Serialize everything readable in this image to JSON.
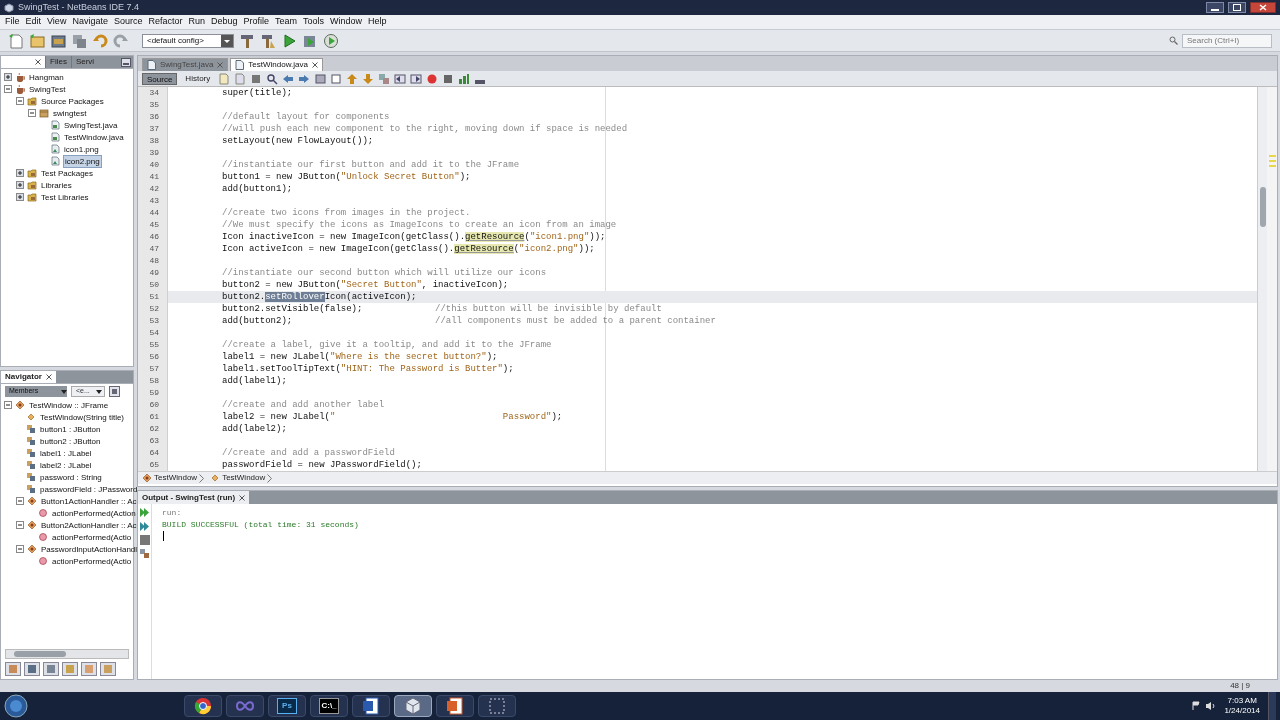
{
  "window": {
    "title": "SwingTest - NetBeans IDE 7.4"
  },
  "menu": [
    "File",
    "Edit",
    "View",
    "Navigate",
    "Source",
    "Refactor",
    "Run",
    "Debug",
    "Profile",
    "Team",
    "Tools",
    "Window",
    "Help"
  ],
  "toolbar": {
    "config": "<default config>",
    "search_placeholder": "Search (Ctrl+I)"
  },
  "projects_panel": {
    "tabs": [
      {
        "selected": true
      },
      {
        "label": "Files",
        "selected": false
      },
      {
        "label": "Servi",
        "selected": false
      }
    ],
    "tree": [
      {
        "label": "Hangman",
        "kind": "project",
        "expanded": false,
        "selected": false
      },
      {
        "label": "SwingTest",
        "kind": "project",
        "expanded": true,
        "selected": false,
        "children": [
          {
            "label": "Source Packages",
            "kind": "folder",
            "expanded": true,
            "selected": false,
            "children": [
              {
                "label": "swingtest",
                "kind": "package",
                "expanded": true,
                "selected": false,
                "children": [
                  {
                    "label": "SwingTest.java",
                    "kind": "java",
                    "selected": false
                  },
                  {
                    "label": "TestWindow.java",
                    "kind": "java",
                    "selected": false
                  },
                  {
                    "label": "icon1.png",
                    "kind": "image",
                    "selected": false
                  },
                  {
                    "label": "icon2.png",
                    "kind": "image",
                    "selected": true
                  }
                ]
              }
            ]
          },
          {
            "label": "Test Packages",
            "kind": "folder",
            "expanded": false,
            "selected": false
          },
          {
            "label": "Libraries",
            "kind": "folder",
            "expanded": false,
            "selected": false
          },
          {
            "label": "Test Libraries",
            "kind": "folder",
            "expanded": false,
            "selected": false
          }
        ]
      }
    ]
  },
  "navigator": {
    "title": "Navigator",
    "filter": "Members",
    "filter_2": "<e...",
    "tree": [
      {
        "label": "TestWindow :: JFrame",
        "kind": "class",
        "expanded": true,
        "children": [
          {
            "label": "TestWindow(String title)",
            "kind": "constructor"
          },
          {
            "label": "button1 : JButton",
            "kind": "field"
          },
          {
            "label": "button2 : JButton",
            "kind": "field"
          },
          {
            "label": "label1 : JLabel",
            "kind": "field"
          },
          {
            "label": "label2 : JLabel",
            "kind": "field"
          },
          {
            "label": "password : String",
            "kind": "field"
          },
          {
            "label": "passwordField : JPassword",
            "kind": "field"
          },
          {
            "label": "Button1ActionHandler :: Ac",
            "kind": "class",
            "expanded": true,
            "children": [
              {
                "label": "actionPerformed(Action",
                "kind": "method"
              }
            ]
          },
          {
            "label": "Button2ActionHandler :: Ac",
            "kind": "class",
            "expanded": true,
            "children": [
              {
                "label": "actionPerformed(Actio",
                "kind": "method"
              }
            ]
          },
          {
            "label": "PasswordInputActionHandl",
            "kind": "class",
            "expanded": true,
            "children": [
              {
                "label": "actionPerformed(Actio",
                "kind": "method"
              }
            ]
          }
        ]
      }
    ]
  },
  "editor": {
    "tabs": [
      {
        "label": "SwingTest.java",
        "selected": false
      },
      {
        "label": "TestWindow.java",
        "selected": true
      }
    ],
    "view_buttons": [
      {
        "label": "Source",
        "selected": true
      },
      {
        "label": "History",
        "selected": false
      }
    ],
    "lines": [
      {
        "number": "34",
        "current": false,
        "segments": [
          {
            "kind": "code",
            "text": "super(title);"
          }
        ]
      },
      {
        "number": "35",
        "current": false
      },
      {
        "number": "36",
        "current": false,
        "segments": [
          {
            "kind": "comment",
            "text": "//default layout for components"
          }
        ]
      },
      {
        "number": "37",
        "current": false,
        "segments": [
          {
            "kind": "comment",
            "text": "//will push each new component to the right, moving down if space is needed"
          }
        ]
      },
      {
        "number": "38",
        "current": false,
        "segments": [
          {
            "kind": "code",
            "text": "setLayout(new FlowLayout());"
          }
        ]
      },
      {
        "number": "39",
        "current": false
      },
      {
        "number": "40",
        "current": false,
        "segments": [
          {
            "kind": "comment",
            "text": "//instantiate our first button and add it to the JFrame"
          }
        ]
      },
      {
        "number": "41",
        "current": false,
        "segments": [
          {
            "kind": "code",
            "text": "button1 = new JButton("
          },
          {
            "kind": "string",
            "text": "\"Unlock Secret Button\""
          },
          {
            "kind": "code",
            "text": ");"
          }
        ]
      },
      {
        "number": "42",
        "current": false,
        "segments": [
          {
            "kind": "code",
            "text": "add(button1);"
          }
        ]
      },
      {
        "number": "43",
        "current": false
      },
      {
        "number": "44",
        "current": false,
        "segments": [
          {
            "kind": "comment",
            "text": "//create two icons from images in the project."
          }
        ]
      },
      {
        "number": "45",
        "current": false,
        "segments": [
          {
            "kind": "comment",
            "text": "//We must specify the icons as ImageIcons to create an icon from an image"
          }
        ]
      },
      {
        "number": "46",
        "current": false,
        "segments": [
          {
            "kind": "code",
            "text": "Icon inactiveIcon = new ImageIcon(getClass()."
          },
          {
            "kind": "match",
            "text": "getResource"
          },
          {
            "kind": "code",
            "text": "("
          },
          {
            "kind": "string",
            "text": "\"icon1.png\""
          },
          {
            "kind": "code",
            "text": "));"
          }
        ]
      },
      {
        "number": "47",
        "current": false,
        "segments": [
          {
            "kind": "code",
            "text": "Icon activeIcon = new ImageIcon(getClass()."
          },
          {
            "kind": "match",
            "text": "getResource"
          },
          {
            "kind": "code",
            "text": "("
          },
          {
            "kind": "string",
            "text": "\"icon2.png\""
          },
          {
            "kind": "code",
            "text": "));"
          }
        ]
      },
      {
        "number": "48",
        "current": false
      },
      {
        "number": "49",
        "current": false,
        "segments": [
          {
            "kind": "comment",
            "text": "//instantiate our second button which will utilize our icons"
          }
        ]
      },
      {
        "number": "50",
        "current": false,
        "segments": [
          {
            "kind": "code",
            "text": "button2 = new JButton("
          },
          {
            "kind": "string",
            "text": "\"Secret Button\""
          },
          {
            "kind": "code",
            "text": ", inactiveIcon);"
          }
        ]
      },
      {
        "number": "51",
        "current": true,
        "segments": [
          {
            "kind": "code",
            "text": "button2."
          },
          {
            "kind": "selection",
            "text": "setRollover"
          },
          {
            "kind": "code",
            "text": "Icon(activeIcon);"
          }
        ]
      },
      {
        "number": "52",
        "current": false,
        "segments": [
          {
            "kind": "code",
            "text": "button2.setVisible(false);"
          }
        ],
        "comment": "//this button will be invisible by default"
      },
      {
        "number": "53",
        "current": false,
        "segments": [
          {
            "kind": "code",
            "text": "add(button2);"
          }
        ],
        "comment": "//all components must be added to a parent container"
      },
      {
        "number": "54",
        "current": false
      },
      {
        "number": "55",
        "current": false,
        "segments": [
          {
            "kind": "comment",
            "text": "//create a label, give it a tooltip, and add it to the JFrame"
          }
        ]
      },
      {
        "number": "56",
        "current": false,
        "segments": [
          {
            "kind": "code",
            "text": "label1 = new JLabel("
          },
          {
            "kind": "string",
            "text": "\"Where is the secret button?\""
          },
          {
            "kind": "code",
            "text": ");"
          }
        ]
      },
      {
        "number": "57",
        "current": false,
        "segments": [
          {
            "kind": "code",
            "text": "label1.setToolTipText("
          },
          {
            "kind": "string",
            "text": "\"HINT: The Password is Butter\""
          },
          {
            "kind": "code",
            "text": ");"
          }
        ]
      },
      {
        "number": "58",
        "current": false,
        "segments": [
          {
            "kind": "code",
            "text": "add(label1);"
          }
        ]
      },
      {
        "number": "59",
        "current": false
      },
      {
        "number": "60",
        "current": false,
        "segments": [
          {
            "kind": "comment",
            "text": "//create and add another label"
          }
        ]
      },
      {
        "number": "61",
        "current": false,
        "segments": [
          {
            "kind": "code",
            "text": "label2 = new JLabel("
          },
          {
            "kind": "string",
            "text": "\"                               Password\""
          },
          {
            "kind": "code",
            "text": ");"
          }
        ]
      },
      {
        "number": "62",
        "current": false,
        "segments": [
          {
            "kind": "code",
            "text": "add(label2);"
          }
        ]
      },
      {
        "number": "63",
        "current": false
      },
      {
        "number": "64",
        "current": false,
        "segments": [
          {
            "kind": "comment",
            "text": "//create and add a passwordField"
          }
        ]
      },
      {
        "number": "65",
        "current": false,
        "segments": [
          {
            "kind": "code",
            "text": "passwordField = new JPasswordField();"
          }
        ]
      }
    ]
  },
  "breadcrumb": [
    "TestWindow",
    "TestWindow"
  ],
  "output": {
    "tab": "Output - SwingTest (run)",
    "lines": [
      {
        "kind": "echo",
        "text": "run:"
      },
      {
        "kind": "success",
        "text": "BUILD SUCCESSFUL (total time: 31 seconds)"
      }
    ]
  },
  "status_bar": {
    "position": "48 | 9"
  },
  "taskbar": {
    "items": [
      {
        "kind": "browser",
        "active": false
      },
      {
        "kind": "infinity",
        "active": false
      },
      {
        "kind": "photoshop",
        "glyph": "Ps",
        "active": false
      },
      {
        "kind": "console",
        "glyph": "C:\\_",
        "active": false
      },
      {
        "kind": "word",
        "active": false
      },
      {
        "kind": "cube",
        "active": true
      },
      {
        "kind": "slides",
        "active": false
      },
      {
        "kind": "snip",
        "active": false
      }
    ],
    "time": "7:03 AM",
    "date": "1/24/2014"
  }
}
